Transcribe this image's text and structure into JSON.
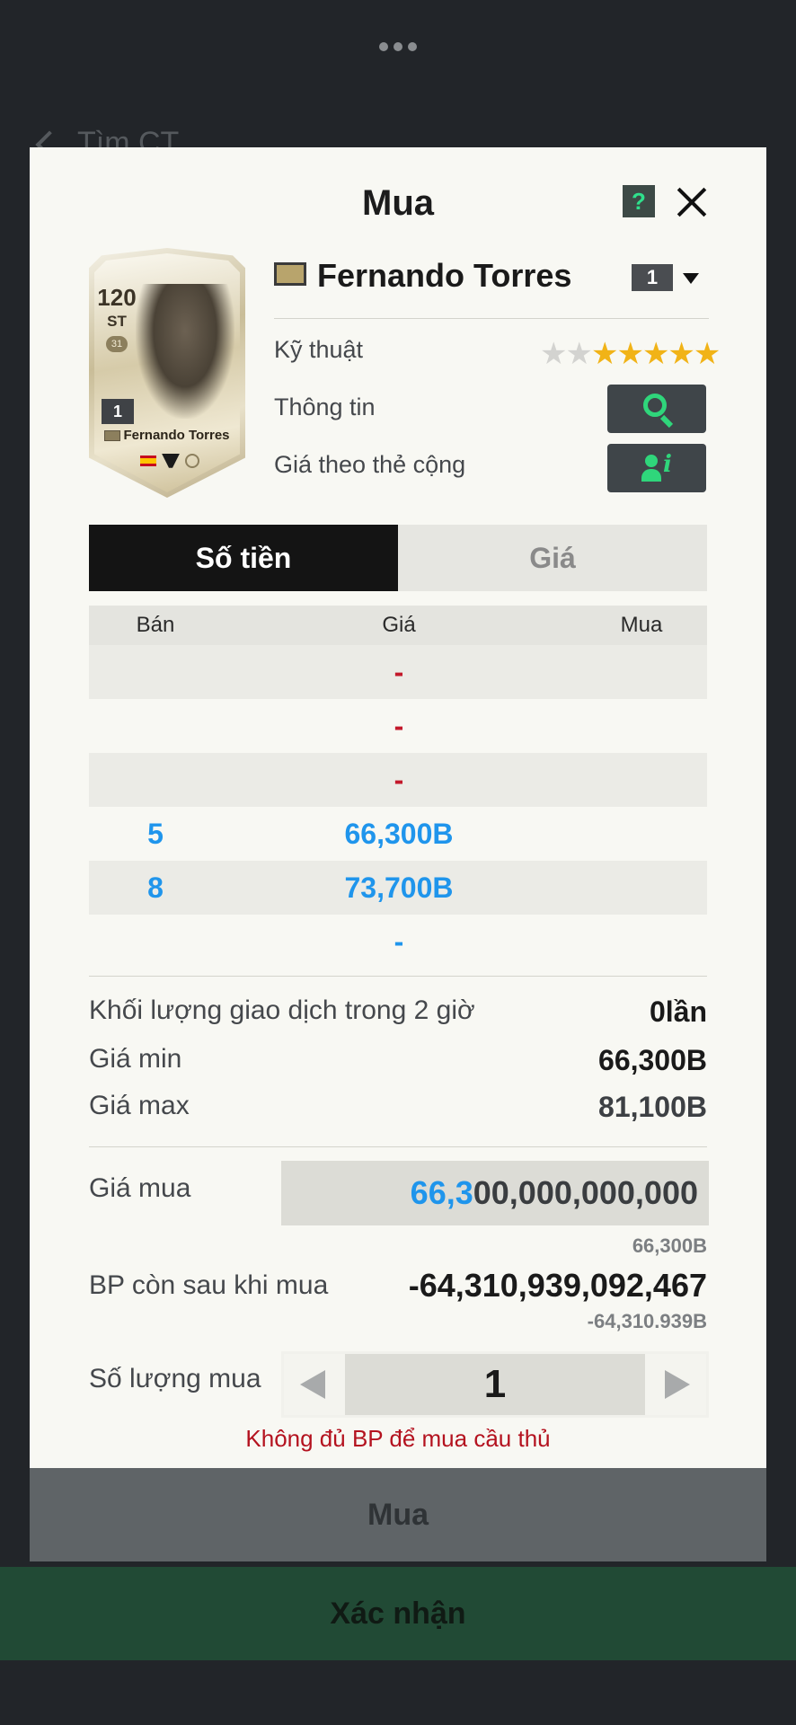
{
  "background": {
    "header_text": "Tìm CT"
  },
  "modal": {
    "title": "Mua",
    "help_label": "?",
    "card": {
      "ovr": "120",
      "position": "ST",
      "badge": "31",
      "level": "1",
      "name": "Fernando Torres"
    },
    "player": {
      "name": "Fernando Torres",
      "level": "1",
      "skill_label": "Kỹ thuật",
      "skill_stars": 5,
      "skill_max_stars": 7,
      "info_label": "Thông tin",
      "price_by_upgrade_label": "Giá theo thẻ cộng"
    },
    "tabs": [
      {
        "label": "Số tiền",
        "active": true
      },
      {
        "label": "Giá",
        "active": false
      }
    ],
    "table": {
      "headers": {
        "sell": "Bán",
        "price": "Giá",
        "buy": "Mua"
      },
      "rows": [
        {
          "sell": "",
          "price": "-",
          "buy": ""
        },
        {
          "sell": "",
          "price": "-",
          "buy": ""
        },
        {
          "sell": "",
          "price": "-",
          "buy": ""
        },
        {
          "sell": "5",
          "price": "66,300B",
          "buy": ""
        },
        {
          "sell": "8",
          "price": "73,700B",
          "buy": ""
        },
        {
          "sell": "",
          "price": "-",
          "buy": ""
        }
      ]
    },
    "stats": {
      "volume_label": "Khối lượng giao dịch trong 2 giờ",
      "volume_value": "0lần",
      "min_label": "Giá min",
      "min_value": "66,300B",
      "max_label": "Giá max",
      "max_value": "81,100B"
    },
    "purchase": {
      "price_label": "Giá mua",
      "price_highlight": "66,3",
      "price_rest": "00,000,000,000",
      "price_short": "66,300B",
      "bp_after_label": "BP còn sau khi mua",
      "bp_after_value": "-64,310,939,092,467",
      "bp_after_short": "-64,310.939B",
      "quantity_label": "Số lượng mua",
      "quantity_value": "1",
      "error_message": "Không đủ BP để mua cầu thủ"
    },
    "buy_button": "Mua"
  },
  "confirm_button": "Xác nhận",
  "colors": {
    "accent_blue": "#1f95ec",
    "error_red": "#b4121f",
    "star_gold": "#f1b317",
    "icon_green": "#2fd67b",
    "confirm_green": "#214a35"
  }
}
